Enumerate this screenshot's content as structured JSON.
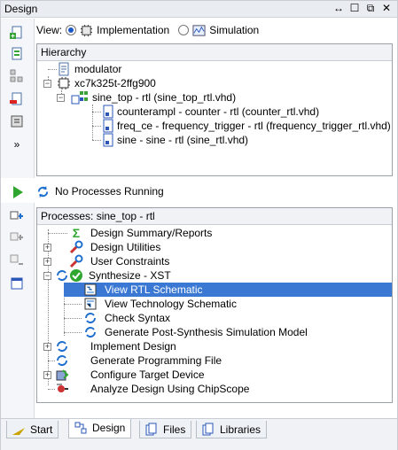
{
  "window": {
    "title": "Design",
    "controls": [
      "↔",
      "☐",
      "⧉",
      "✕"
    ]
  },
  "view": {
    "label": "View:",
    "options": [
      {
        "label": "Implementation",
        "selected": true
      },
      {
        "label": "Simulation",
        "selected": false
      }
    ]
  },
  "hierarchy": {
    "header": "Hierarchy",
    "items": [
      {
        "label": "modulator",
        "icon": "document-icon"
      },
      {
        "label": "xc7k325t-2ffg900",
        "icon": "chip-icon"
      },
      {
        "label": "sine_top - rtl (sine_top_rtl.vhd)",
        "icon": "module-icon"
      },
      {
        "label": "counterampl - counter - rtl (counter_rtl.vhd)",
        "icon": "vhdl-file-icon"
      },
      {
        "label": "freq_ce - frequency_trigger - rtl (frequency_trigger_rtl.vhd)",
        "icon": "vhdl-file-icon"
      },
      {
        "label": "sine - sine - rtl (sine_rtl.vhd)",
        "icon": "vhdl-file-icon"
      }
    ]
  },
  "status": {
    "text": "No Processes Running"
  },
  "processes": {
    "header": "Processes: sine_top - rtl",
    "items": [
      {
        "label": "Design Summary/Reports"
      },
      {
        "label": "Design Utilities"
      },
      {
        "label": "User Constraints"
      },
      {
        "label": "Synthesize - XST"
      },
      {
        "label": "View RTL Schematic"
      },
      {
        "label": "View Technology Schematic"
      },
      {
        "label": "Check Syntax"
      },
      {
        "label": "Generate Post-Synthesis Simulation Model"
      },
      {
        "label": "Implement Design"
      },
      {
        "label": "Generate Programming File"
      },
      {
        "label": "Configure Target Device"
      },
      {
        "label": "Analyze Design Using ChipScope"
      }
    ],
    "selected": "View RTL Schematic"
  },
  "tabs": [
    {
      "label": "Start",
      "active": false
    },
    {
      "label": "Design",
      "active": true
    },
    {
      "label": "Files",
      "active": false
    },
    {
      "label": "Libraries",
      "active": false
    }
  ],
  "colors": {
    "selection": "#3a78d4",
    "check_green": "#2fa62f",
    "run_blue": "#1f6fd0"
  }
}
